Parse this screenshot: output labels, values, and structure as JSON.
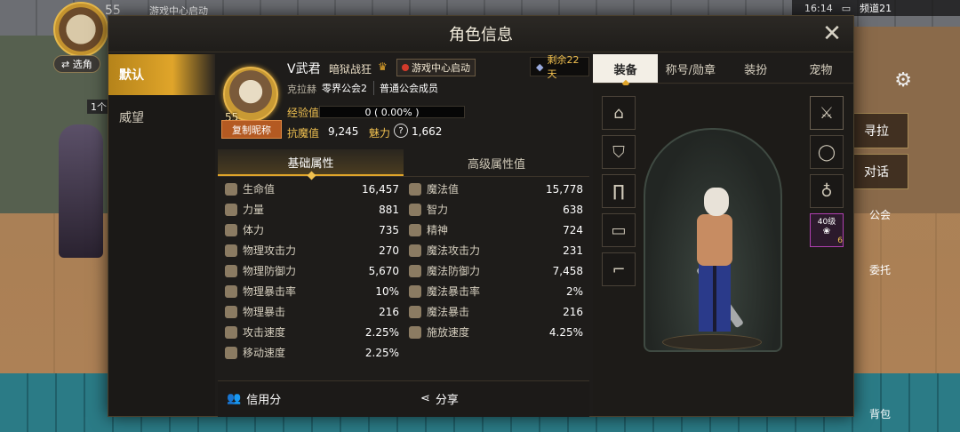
{
  "hud": {
    "level": "55",
    "top_text": "游戏中心启动",
    "select_label": "⇄ 选角",
    "count": "1个",
    "time": "16:14",
    "channel": "频道21",
    "right_buttons": [
      "寻拉",
      "对话"
    ],
    "side_labels": [
      "公会",
      "委托",
      "背包"
    ]
  },
  "dialog": {
    "title": "角色信息",
    "left_tabs": [
      "默认",
      "威望"
    ],
    "profile": {
      "level": "55",
      "copy_label": "复制昵称",
      "name": "V武君",
      "class": "暗狱战狂",
      "game_center": "游戏中心启动",
      "remaining": "剩余22天",
      "server": "克拉赫",
      "guild": "零界公会2",
      "member": "普通公会成员",
      "exp_label": "经验值",
      "exp_value": "0 ( 0.00% )",
      "resist_label": "抗魔值",
      "resist_value": "9,245",
      "charm_label": "魅力",
      "charm_value": "1,662"
    },
    "stat_tabs": [
      "基础属性",
      "高级属性值"
    ],
    "stats": [
      {
        "l_label": "生命值",
        "l_val": "16,457",
        "r_label": "魔法值",
        "r_val": "15,778"
      },
      {
        "l_label": "力量",
        "l_val": "881",
        "r_label": "智力",
        "r_val": "638"
      },
      {
        "l_label": "体力",
        "l_val": "735",
        "r_label": "精神",
        "r_val": "724"
      },
      {
        "l_label": "物理攻击力",
        "l_val": "270",
        "r_label": "魔法攻击力",
        "r_val": "231"
      },
      {
        "l_label": "物理防御力",
        "l_val": "5,670",
        "r_label": "魔法防御力",
        "r_val": "7,458"
      },
      {
        "l_label": "物理暴击率",
        "l_val": "10%",
        "r_label": "魔法暴击率",
        "r_val": "2%"
      },
      {
        "l_label": "物理暴击",
        "l_val": "216",
        "r_label": "魔法暴击",
        "r_val": "216"
      },
      {
        "l_label": "攻击速度",
        "l_val": "2.25%",
        "r_label": "施放速度",
        "r_val": "4.25%"
      },
      {
        "l_label": "移动速度",
        "l_val": "2.25%",
        "r_label": "",
        "r_val": ""
      }
    ],
    "bottom": {
      "credit": "信用分",
      "share": "分享"
    },
    "right_tabs": [
      "装备",
      "称号/勋章",
      "装扮",
      "宠物"
    ],
    "pet_slot": {
      "level": "40级",
      "count": "6"
    }
  }
}
